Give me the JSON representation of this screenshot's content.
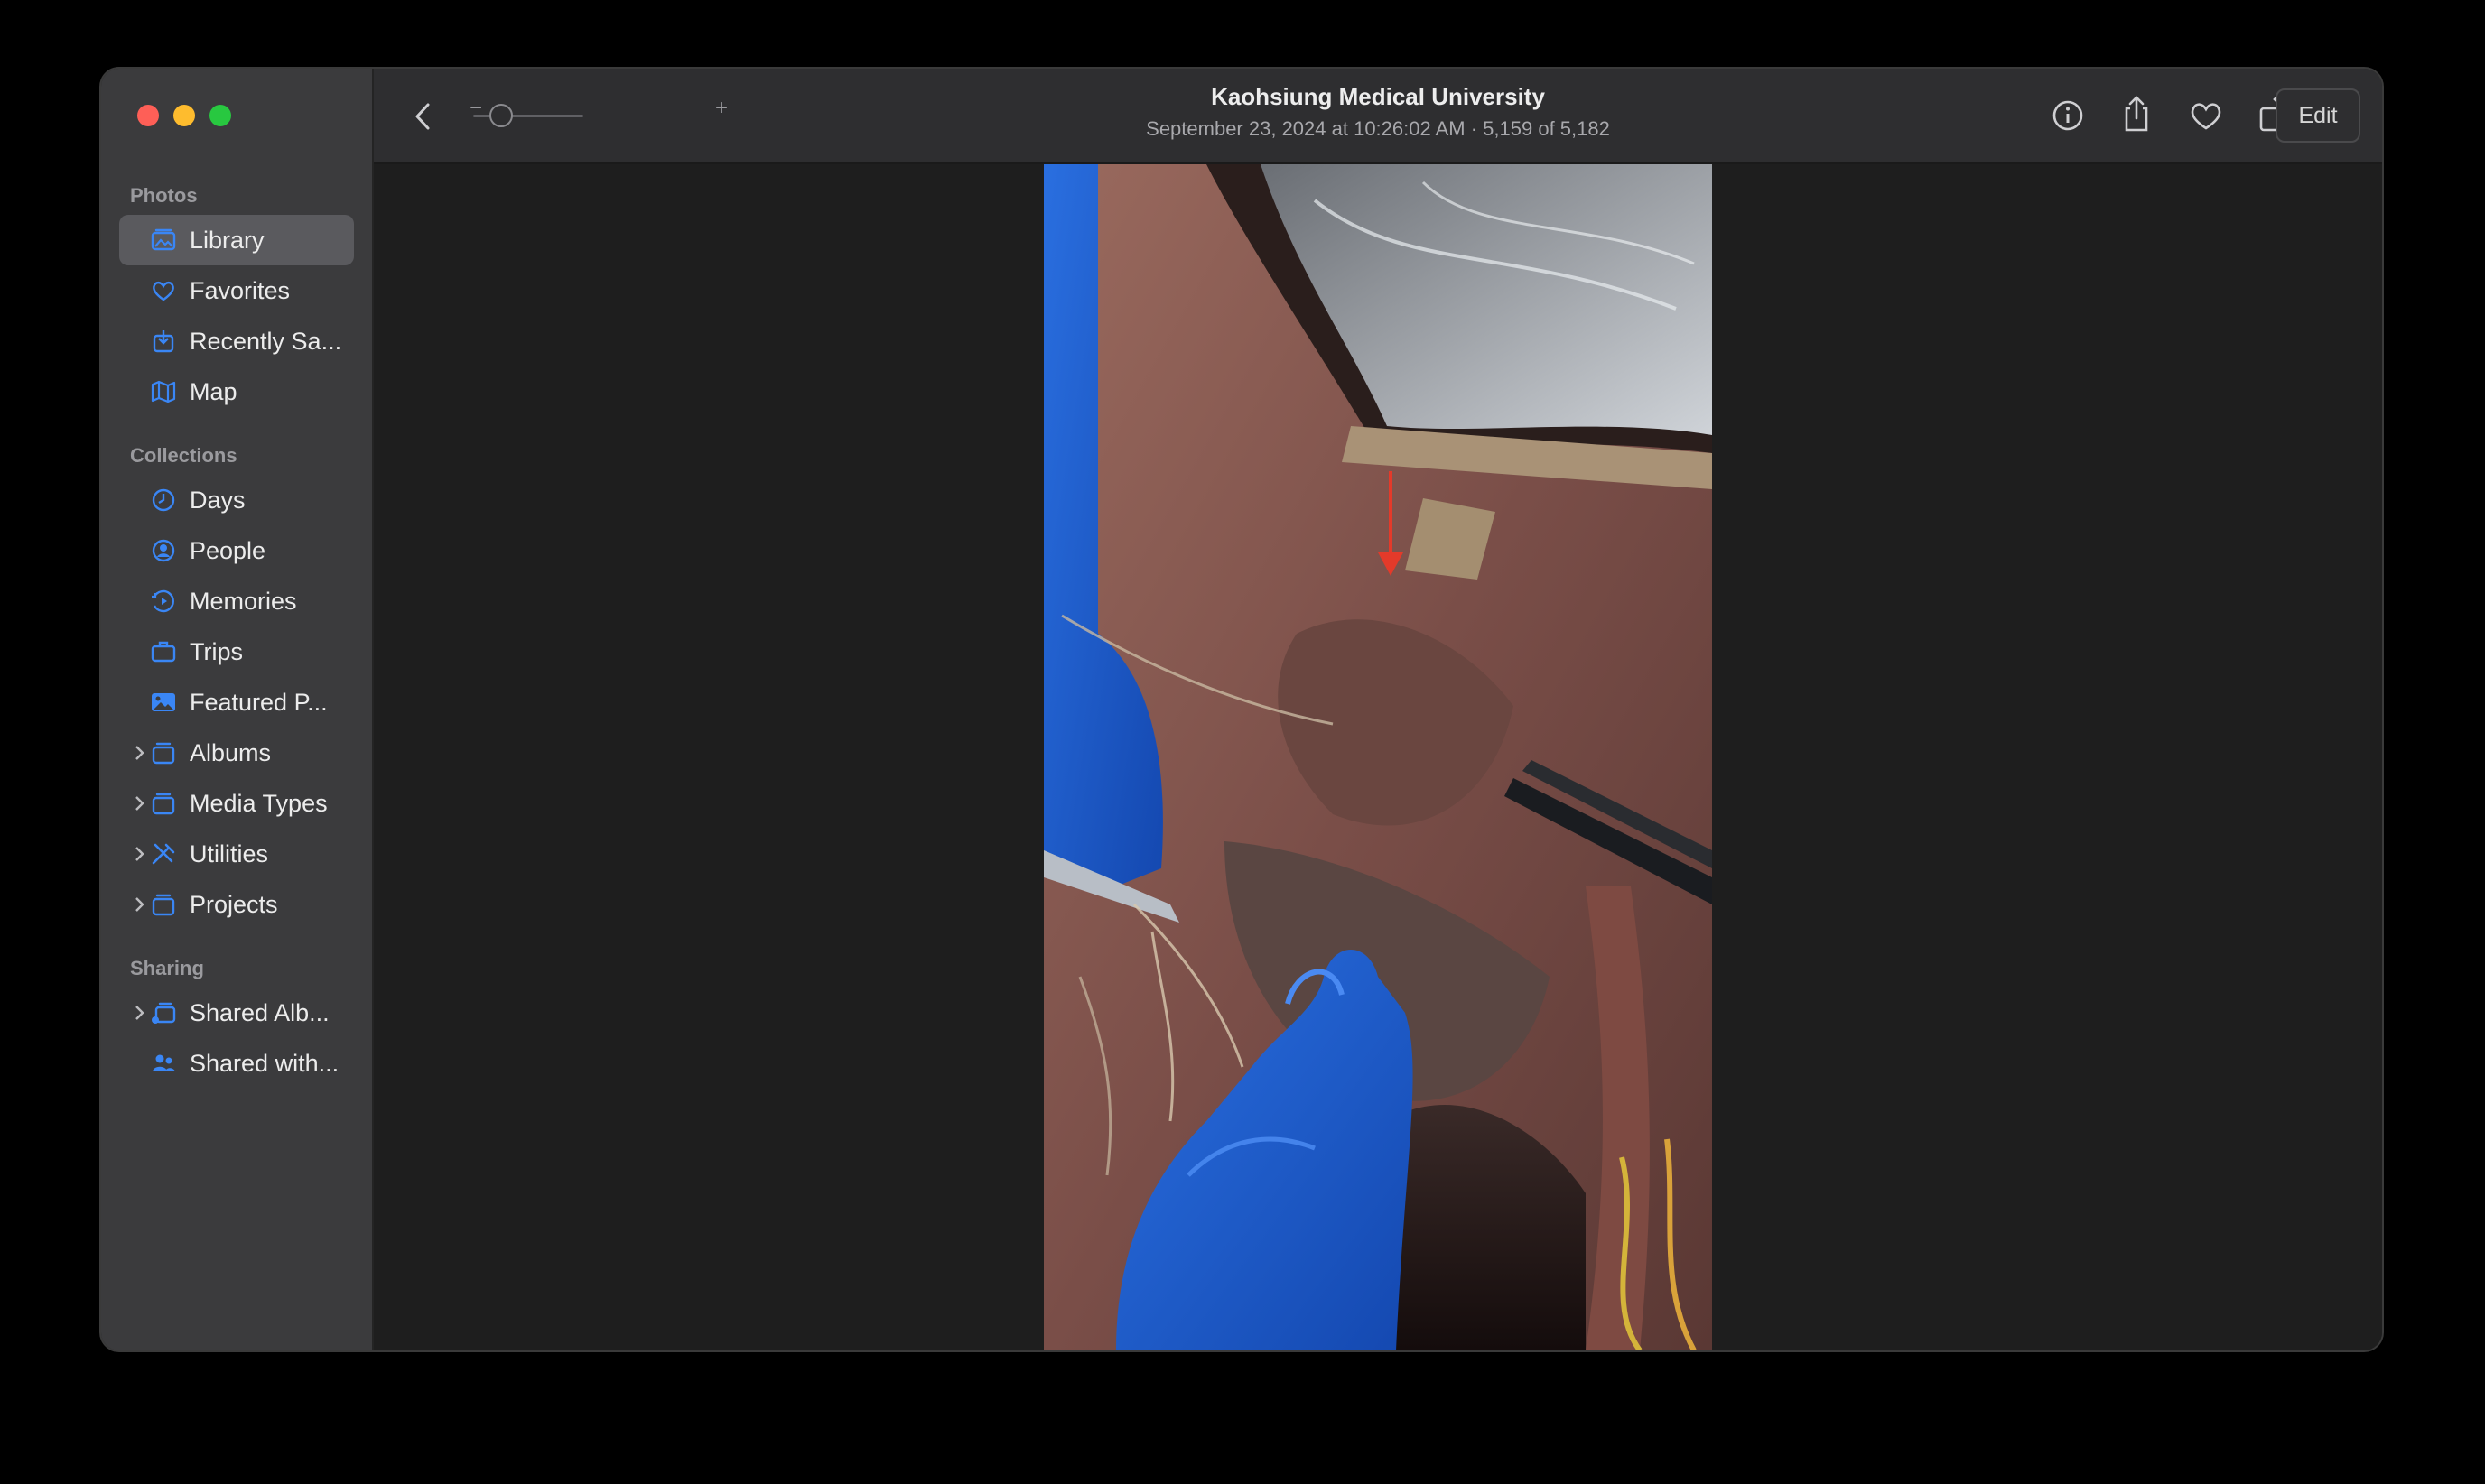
{
  "window": {
    "title": "Kaohsiung Medical University",
    "subtitle": "September 23, 2024 at 10:26:02 AM  ·  5,159 of 5,182"
  },
  "toolbar": {
    "zoom_minus": "−",
    "zoom_plus": "+",
    "edit_label": "Edit",
    "icons": [
      "back-icon",
      "info-icon",
      "share-icon",
      "favorite-icon",
      "rotate-icon",
      "auto-enhance-icon"
    ]
  },
  "sidebar": {
    "sections": [
      {
        "header": "Photos",
        "items": [
          {
            "label": "Library",
            "icon": "library-icon",
            "selected": true
          },
          {
            "label": "Favorites",
            "icon": "heart-icon"
          },
          {
            "label": "Recently Sa...",
            "icon": "recently-saved-icon"
          },
          {
            "label": "Map",
            "icon": "map-icon"
          }
        ]
      },
      {
        "header": "Collections",
        "items": [
          {
            "label": "Days",
            "icon": "clock-icon"
          },
          {
            "label": "People",
            "icon": "person-icon"
          },
          {
            "label": "Memories",
            "icon": "memories-icon"
          },
          {
            "label": "Trips",
            "icon": "suitcase-icon"
          },
          {
            "label": "Featured P...",
            "icon": "photo-icon"
          },
          {
            "label": "Albums",
            "icon": "folder-icon",
            "expandable": true
          },
          {
            "label": "Media Types",
            "icon": "folder-icon",
            "expandable": true
          },
          {
            "label": "Utilities",
            "icon": "tools-icon",
            "expandable": true
          },
          {
            "label": "Projects",
            "icon": "folder-icon",
            "expandable": true
          }
        ]
      },
      {
        "header": "Sharing",
        "items": [
          {
            "label": "Shared Alb...",
            "icon": "shared-album-icon",
            "expandable": true
          },
          {
            "label": "Shared with...",
            "icon": "shared-people-icon"
          }
        ]
      }
    ]
  },
  "colors": {
    "accent": "#3a86f5",
    "sidebar_bg": "#3b3b3d",
    "content_bg": "#1e1e1e"
  }
}
